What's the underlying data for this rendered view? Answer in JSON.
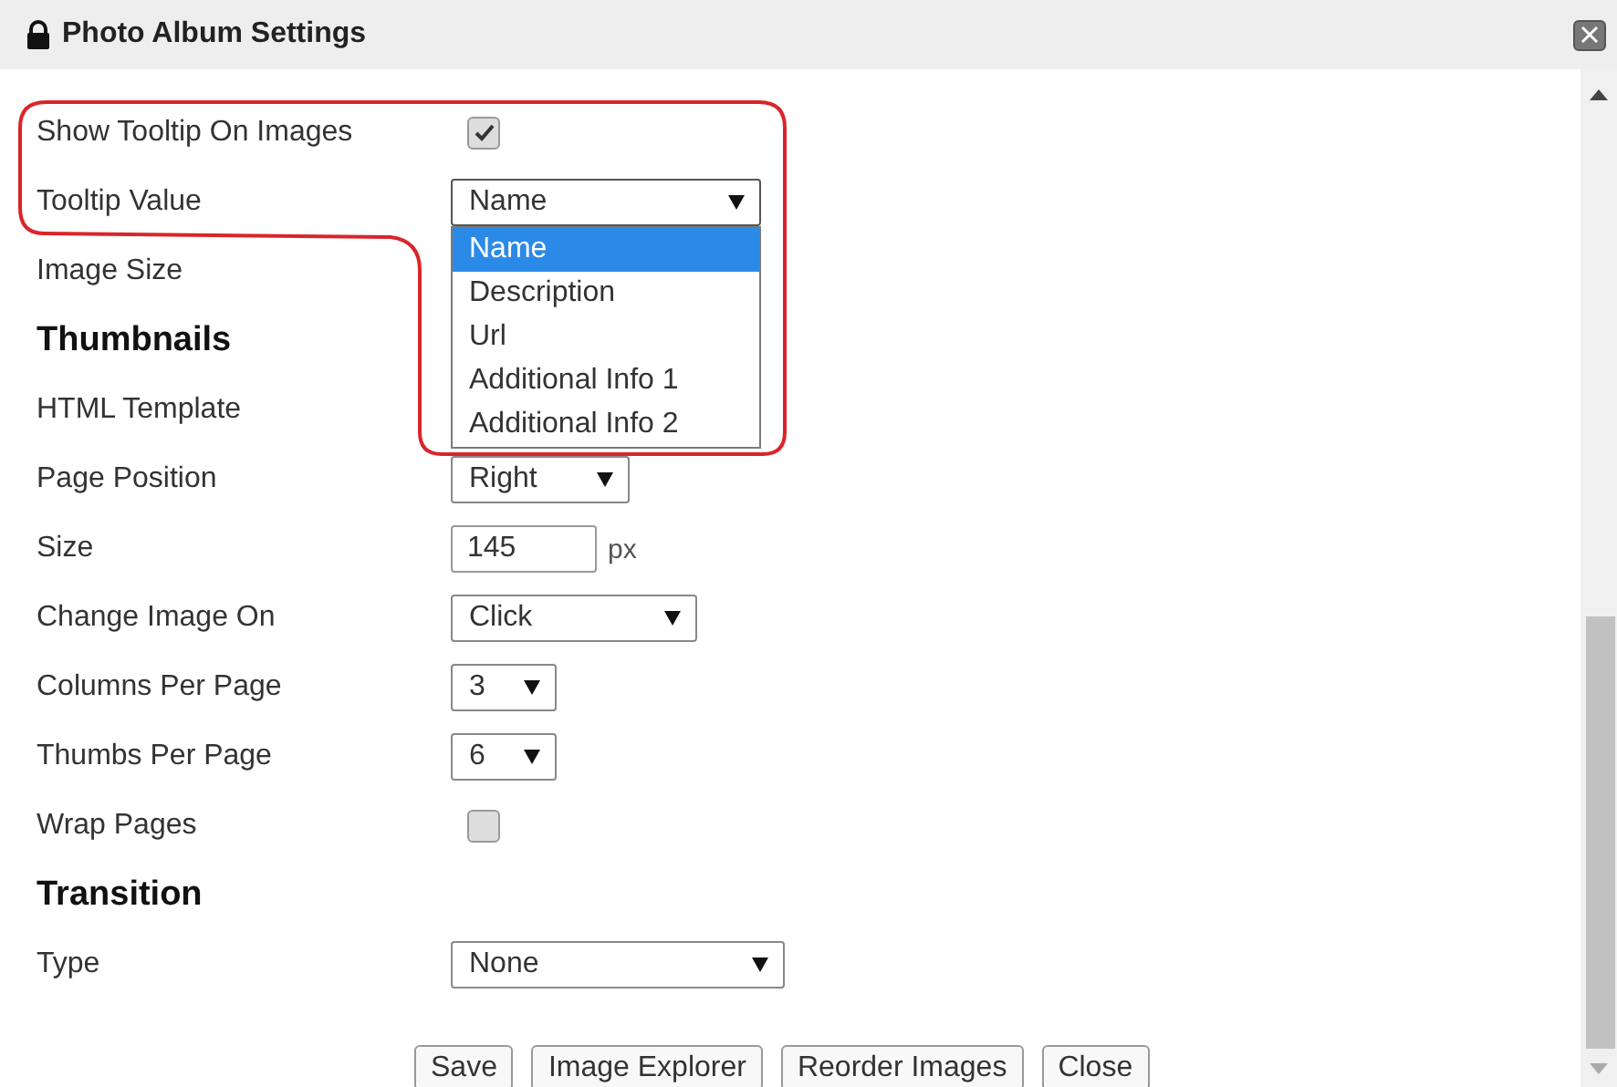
{
  "window": {
    "title": "Photo Album Settings"
  },
  "rows": [
    {
      "kind": "checkbox",
      "label": "Show Tooltip On Images",
      "checked": true
    },
    {
      "kind": "dropdown",
      "label": "Tooltip Value",
      "value": "Name",
      "open": true,
      "options": [
        {
          "label": "Name",
          "selected": true
        },
        {
          "label": "Description",
          "selected": false
        },
        {
          "label": "Url",
          "selected": false
        },
        {
          "label": "Additional Info 1",
          "selected": false
        },
        {
          "label": "Additional Info 2",
          "selected": false
        }
      ]
    },
    {
      "kind": "label",
      "label": "Image Size"
    },
    {
      "kind": "heading",
      "label": "Thumbnails"
    },
    {
      "kind": "label",
      "label": "HTML Template"
    },
    {
      "kind": "select",
      "label": "Page Position",
      "value": "Right"
    },
    {
      "kind": "input",
      "label": "Size",
      "value": "145",
      "unit": "px"
    },
    {
      "kind": "select",
      "label": "Change Image On",
      "value": "Click"
    },
    {
      "kind": "select",
      "label": "Columns Per Page",
      "value": "3"
    },
    {
      "kind": "select",
      "label": "Thumbs Per Page",
      "value": "6"
    },
    {
      "kind": "checkbox",
      "label": "Wrap Pages",
      "checked": false
    },
    {
      "kind": "heading",
      "label": "Transition"
    },
    {
      "kind": "select",
      "label": "Type",
      "value": "None"
    }
  ],
  "buttons": [
    "Save",
    "Image Explorer",
    "Reorder Images",
    "Close"
  ]
}
